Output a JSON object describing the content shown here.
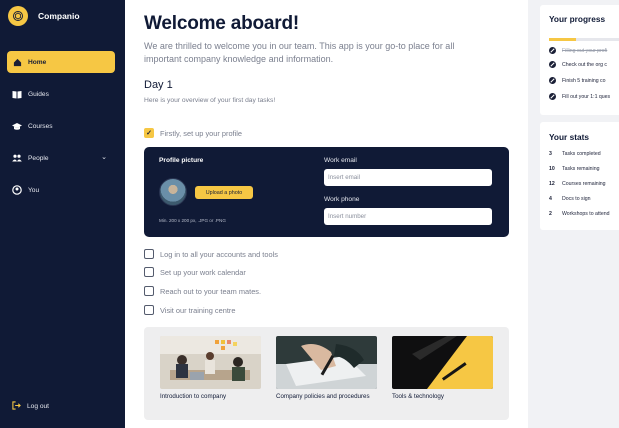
{
  "app": {
    "name": "Companio"
  },
  "sidebar": {
    "items": [
      {
        "label": "Home",
        "icon": "home-icon",
        "active": true
      },
      {
        "label": "Guides",
        "icon": "book-icon"
      },
      {
        "label": "Courses",
        "icon": "graduation-cap-icon"
      },
      {
        "label": "People",
        "icon": "people-icon",
        "has_chevron": true
      },
      {
        "label": "You",
        "icon": "user-icon"
      }
    ],
    "logout_label": "Log out"
  },
  "main": {
    "title": "Welcome aboard!",
    "subtitle": "We are thrilled to welcome you in our team. This app is your go-to place for all important company knowledge and information.",
    "day_title": "Day 1",
    "day_subtitle": "Here is your overview of your first day tasks!",
    "first_task": {
      "label": "Firstly, set up your profile",
      "checked": true
    },
    "profile_card": {
      "picture_label": "Profile picture",
      "upload_button": "Upload a photo",
      "hint": "Min. 200 x 200 px, .JPG or .PNG",
      "email_label": "Work email",
      "email_placeholder": "Insert email",
      "phone_label": "Work phone",
      "phone_placeholder": "Insert number"
    },
    "tasks": [
      {
        "label": "Log in to all your accounts and tools",
        "checked": false
      },
      {
        "label": "Set up your work calendar",
        "checked": false
      },
      {
        "label": "Reach out to your team mates.",
        "checked": false
      },
      {
        "label": "Visit our training centre",
        "checked": false
      }
    ],
    "tiles": [
      {
        "label": "Introduction to company"
      },
      {
        "label": "Company policies and procedures"
      },
      {
        "label": "Tools & technology"
      }
    ]
  },
  "progress": {
    "title": "Your progress",
    "fill_fraction": 0.29,
    "items": [
      {
        "label": "Filling out your profi",
        "done": true
      },
      {
        "label": "Check out the org c",
        "done": false
      },
      {
        "label": "Finish 5 training co",
        "done": false
      },
      {
        "label": "Fill out your 1:1 ques",
        "done": false
      }
    ]
  },
  "stats": {
    "title": "Your stats",
    "items": [
      {
        "value": "3",
        "label": "Tasks completed"
      },
      {
        "value": "10",
        "label": "Tasks remaining"
      },
      {
        "value": "12",
        "label": "Courses remaining"
      },
      {
        "value": "4",
        "label": "Docs to sign"
      },
      {
        "value": "2",
        "label": "Workshops to attend"
      }
    ]
  },
  "colors": {
    "accent": "#f6c744",
    "navy": "#101a36",
    "muted": "#7a7f8e"
  }
}
